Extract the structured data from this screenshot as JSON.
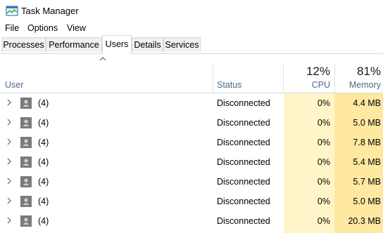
{
  "window": {
    "title": "Task Manager"
  },
  "menu": [
    "File",
    "Options",
    "View"
  ],
  "tabs": [
    "Processes",
    "Performance",
    "Users",
    "Details",
    "Services"
  ],
  "active_tab": "Users",
  "columns": {
    "user": "User",
    "status": "Status",
    "cpu": {
      "label": "CPU",
      "total": "12%"
    },
    "memory": {
      "label": "Memory",
      "total": "81%"
    }
  },
  "rows": [
    {
      "user": "(4)",
      "status": "Disconnected",
      "cpu": "0%",
      "memory": "4.4 MB"
    },
    {
      "user": "(4)",
      "status": "Disconnected",
      "cpu": "0%",
      "memory": "5.0 MB"
    },
    {
      "user": "(4)",
      "status": "Disconnected",
      "cpu": "0%",
      "memory": "7.8 MB"
    },
    {
      "user": "(4)",
      "status": "Disconnected",
      "cpu": "0%",
      "memory": "5.4 MB"
    },
    {
      "user": "(4)",
      "status": "Disconnected",
      "cpu": "0%",
      "memory": "5.7 MB"
    },
    {
      "user": "(4)",
      "status": "Disconnected",
      "cpu": "0%",
      "memory": "5.0 MB"
    },
    {
      "user": "(4)",
      "status": "Disconnected",
      "cpu": "0%",
      "memory": "20.3 MB"
    }
  ],
  "colors": {
    "cpu_heat": "#fff5c8",
    "memory_heat": "#ffe8a0",
    "header_label": "#4a6a8a"
  },
  "icons": {
    "app": "task-manager-icon",
    "row_expand": "chevron-right-icon",
    "row_user": "user-avatar-icon",
    "sort": "sort-ascending-icon"
  }
}
